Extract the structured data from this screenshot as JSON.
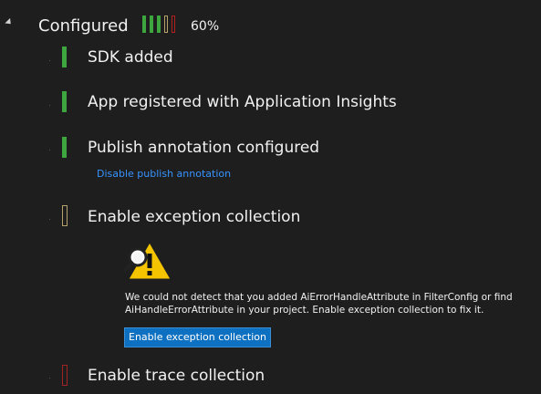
{
  "header": {
    "title": "Configured",
    "progress_text": "60%",
    "progress_fraction": 0.6,
    "progress_segments": [
      "filled",
      "filled",
      "filled",
      "partial",
      "empty"
    ]
  },
  "steps": [
    {
      "label": "SDK added",
      "status": "complete"
    },
    {
      "label": "App registered with Application Insights",
      "status": "complete"
    },
    {
      "label": "Publish annotation configured",
      "status": "complete",
      "link": "Disable publish annotation"
    },
    {
      "label": "Enable exception collection",
      "status": "partial",
      "warning": {
        "icon": "warning-magnifier-icon",
        "message": "We could not detect that you added AiErrorHandleAttribute in FilterConfig or find AiHandleErrorAttribute in your project. Enable exception collection to fix it.",
        "button": "Enable exception collection"
      }
    },
    {
      "label": "Enable trace collection",
      "status": "incomplete"
    }
  ],
  "colors": {
    "background": "#1e1e1e",
    "complete": "#3ea63e",
    "partial": "#b5a26a",
    "incomplete": "#a02424",
    "link": "#3794ff",
    "button": "#0e70c0"
  }
}
